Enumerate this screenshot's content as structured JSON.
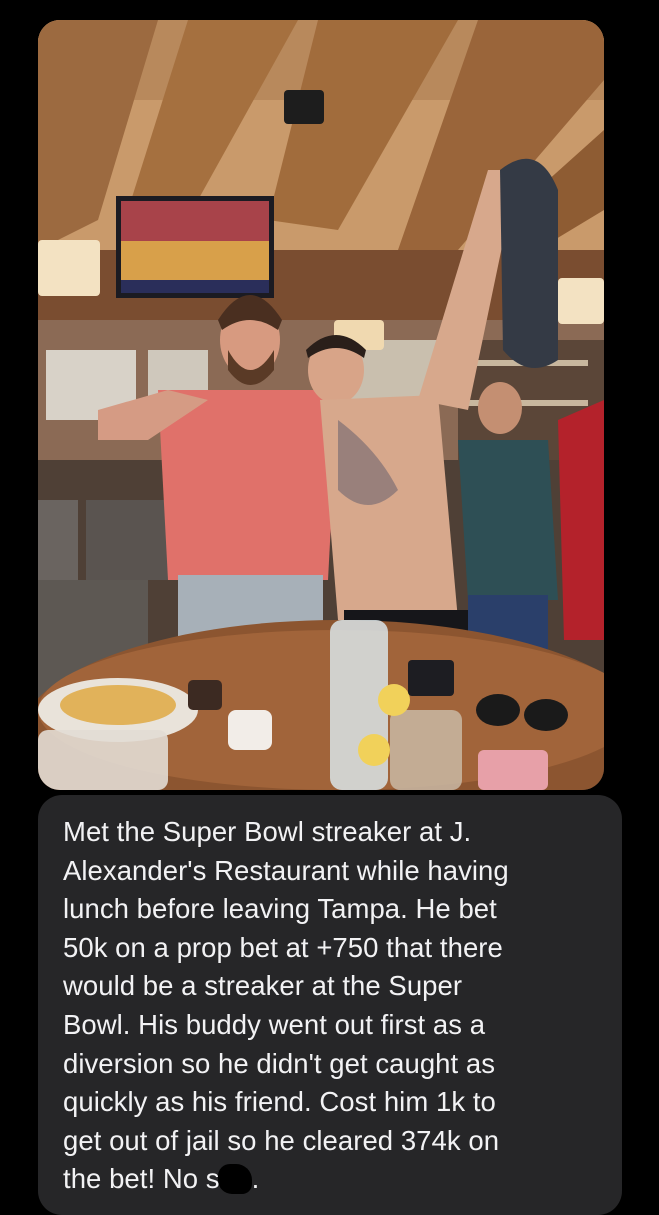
{
  "conversation": {
    "photo": {
      "alt": "photo-attachment"
    },
    "message": {
      "lines": [
        "Met the Super Bowl streaker at J.",
        "Alexander's Restaurant while having",
        "lunch before leaving Tampa. He bet",
        "50k on a prop bet at +750 that there",
        "would be a streaker at the Super",
        "Bowl. His buddy went out first as a",
        "diversion so he didn't get caught as",
        "quickly as his friend. Cost him 1k to",
        "get out of jail so he cleared 374k on"
      ],
      "last_line_start": "the bet! No s",
      "last_line_end": "."
    }
  },
  "colors": {
    "background": "#000000",
    "bubble": "#262628",
    "text": "#f2f2f4"
  }
}
